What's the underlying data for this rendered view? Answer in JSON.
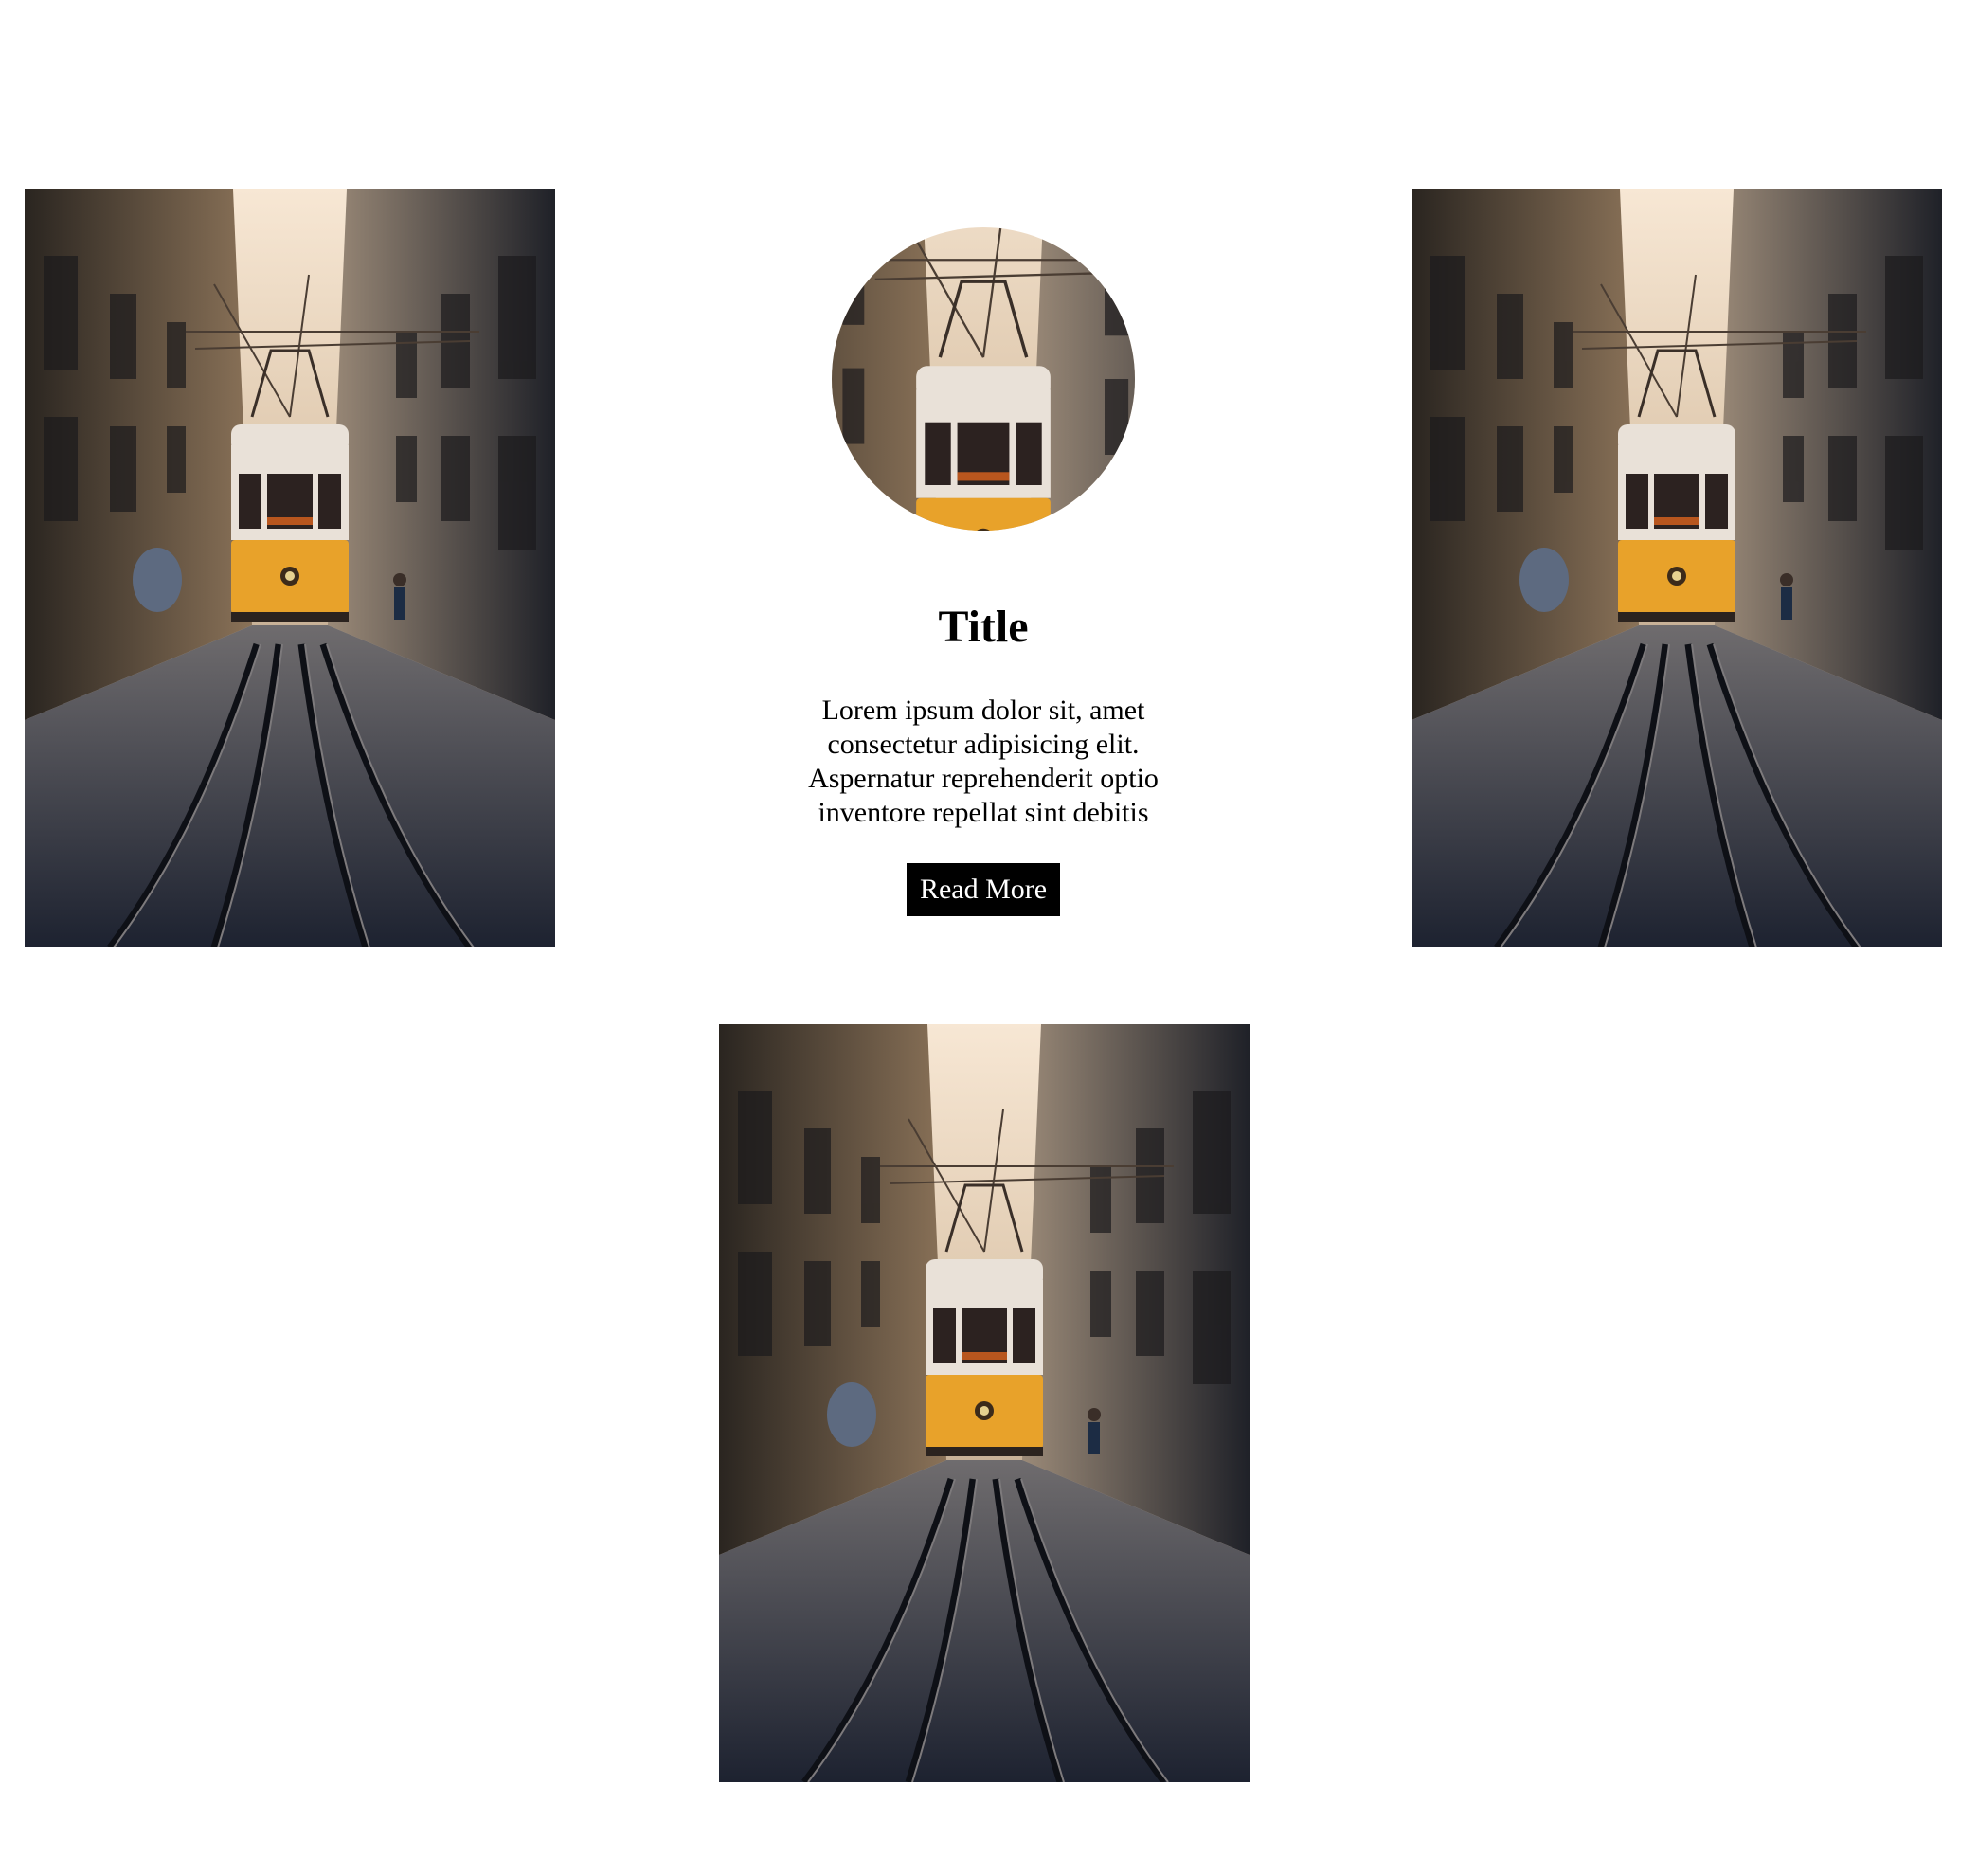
{
  "images": [
    {
      "name": "tram-photo-1",
      "subject": "yellow tram on street"
    },
    {
      "name": "tram-photo-2",
      "subject": "yellow tram on street"
    },
    {
      "name": "tram-photo-3",
      "subject": "yellow tram on street"
    }
  ],
  "card": {
    "avatar_subject": "yellow tram on street",
    "title": "Title",
    "text": "Lorem ipsum dolor sit, amet consectetur adipisicing elit. Aspernatur reprehenderit optio inventore repellat sint debitis",
    "button_label": "Read More"
  },
  "colors": {
    "button_bg": "#000000",
    "button_text": "#ffffff",
    "tram_yellow": "#e8a22a"
  }
}
